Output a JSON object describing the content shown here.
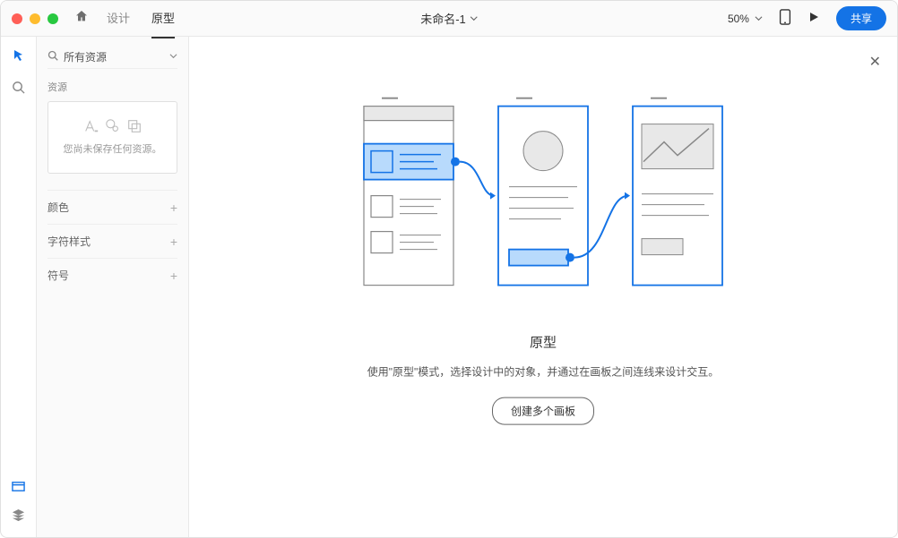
{
  "titlebar": {
    "tabs": {
      "design": "设计",
      "prototype": "原型"
    },
    "doc_title": "未命名-1",
    "zoom": "50%",
    "share": "共享"
  },
  "sidebar": {
    "search_label": "所有资源",
    "assets_heading": "资源",
    "assets_empty": "您尚未保存任何资源。",
    "panels": {
      "colors": "颜色",
      "char_styles": "字符样式",
      "symbols": "符号"
    }
  },
  "canvas": {
    "heading": "原型",
    "description": "使用\"原型\"模式，选择设计中的对象，并通过在画板之间连线来设计交互。",
    "button": "创建多个画板"
  }
}
